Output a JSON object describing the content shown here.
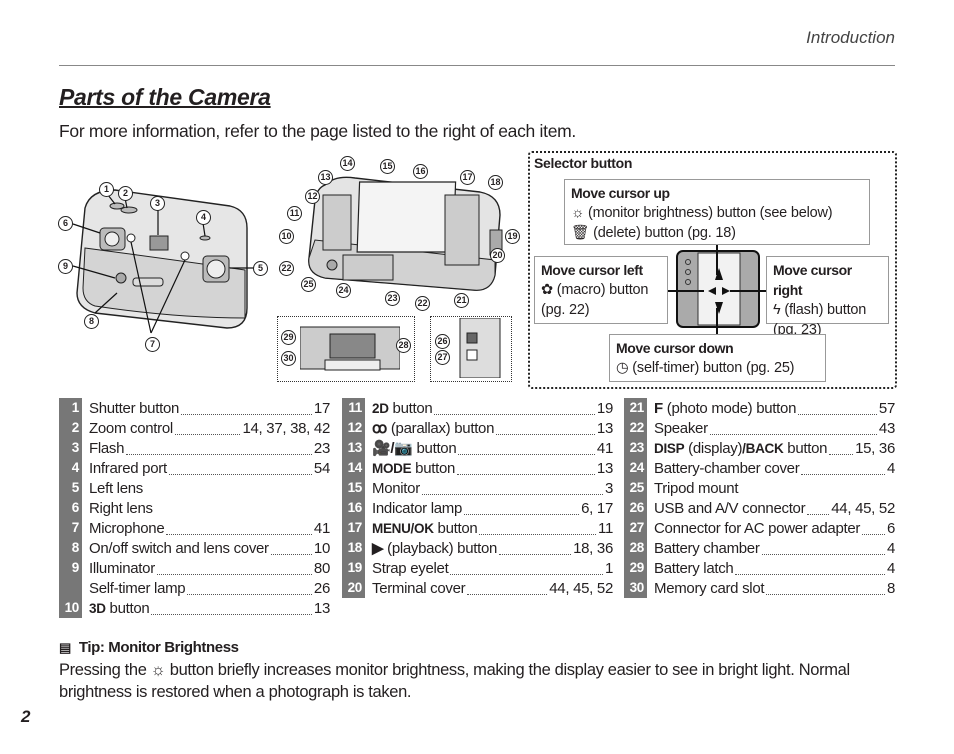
{
  "header": {
    "section": "Introduction"
  },
  "page": {
    "title": "Parts of the Camera",
    "intro": "For more information, refer to the page listed to the right of each item.",
    "number": "2"
  },
  "figures": {
    "front_callouts": [
      "1",
      "2",
      "3",
      "4",
      "5",
      "6",
      "7",
      "8",
      "9"
    ],
    "back_callouts": [
      "10",
      "11",
      "12",
      "13",
      "14",
      "15",
      "16",
      "17",
      "18",
      "19",
      "20",
      "21",
      "22",
      "22",
      "23",
      "24",
      "25"
    ],
    "detail_callouts": [
      "26",
      "27",
      "28",
      "29",
      "30"
    ]
  },
  "selector": {
    "title": "Selector button",
    "up": {
      "heading": "Move cursor up",
      "line1": "(monitor brightness) button (see below)",
      "line2": "(delete) button (pg. 18)"
    },
    "left": {
      "heading": "Move cursor left",
      "line1": "(macro) button",
      "line2": "(pg. 22)"
    },
    "right": {
      "heading": "Move cursor right",
      "line1": "(flash) button",
      "line2": "(pg. 23)"
    },
    "down": {
      "heading": "Move cursor down",
      "line1": "(self-timer) button (pg. 25)"
    }
  },
  "parts": {
    "col1": [
      {
        "n": "1",
        "label": "Shutter button",
        "pages": "17"
      },
      {
        "n": "2",
        "label": "Zoom control",
        "pages": "14, 37, 38, 42"
      },
      {
        "n": "3",
        "label": "Flash",
        "pages": "23"
      },
      {
        "n": "4",
        "label": "Infrared port",
        "pages": "54"
      },
      {
        "n": "5",
        "label": "Left lens",
        "pages": ""
      },
      {
        "n": "6",
        "label": "Right lens",
        "pages": ""
      },
      {
        "n": "7",
        "label": "Microphone",
        "pages": "41"
      },
      {
        "n": "8",
        "label": "On/off switch and lens cover",
        "pages": "10"
      },
      {
        "n": "9",
        "label": "Illuminator",
        "pages": "80"
      },
      {
        "n": "",
        "label": "Self-timer lamp",
        "pages": "26"
      },
      {
        "n": "10",
        "bold": "3D",
        "label": " button",
        "pages": "13"
      }
    ],
    "col2": [
      {
        "n": "11",
        "bold": "2D",
        "label": " button",
        "pages": "19"
      },
      {
        "n": "12",
        "icon": "ꝏ",
        "label": " (parallax) button",
        "pages": "13"
      },
      {
        "n": "13",
        "icon": "🎥/📷",
        "label": " button",
        "pages": "41"
      },
      {
        "n": "14",
        "bold": "MODE",
        "label": " button",
        "pages": "13"
      },
      {
        "n": "15",
        "label": "Monitor",
        "pages": "3"
      },
      {
        "n": "16",
        "label": "Indicator lamp",
        "pages": "6, 17"
      },
      {
        "n": "17",
        "bold": "MENU/OK",
        "label": " button",
        "pages": "11"
      },
      {
        "n": "18",
        "icon": "▶",
        "label": " (playback) button",
        "pages": "18, 36"
      },
      {
        "n": "19",
        "label": "Strap eyelet",
        "pages": "1"
      },
      {
        "n": "20",
        "label": "Terminal cover",
        "pages": "44, 45, 52"
      }
    ],
    "col3": [
      {
        "n": "21",
        "icon": "F",
        "label": " (photo mode) button",
        "pages": "57"
      },
      {
        "n": "22",
        "label": "Speaker",
        "pages": "43"
      },
      {
        "n": "23",
        "bold": "DISP",
        "label": " (display)",
        "bold2": "/BACK",
        "label2": " button",
        "pages": "15, 36"
      },
      {
        "n": "24",
        "label": "Battery-chamber cover",
        "pages": "4"
      },
      {
        "n": "25",
        "label": "Tripod mount",
        "pages": ""
      },
      {
        "n": "26",
        "label": "USB and A/V connector",
        "pages": "44, 45, 52"
      },
      {
        "n": "27",
        "label": "Connector for AC power adapter",
        "pages": "6"
      },
      {
        "n": "28",
        "label": "Battery chamber",
        "pages": "4"
      },
      {
        "n": "29",
        "label": "Battery latch",
        "pages": "4"
      },
      {
        "n": "30",
        "label": "Memory card slot",
        "pages": "8"
      }
    ]
  },
  "tip": {
    "heading": "Tip: Monitor Brightness",
    "body_before": "Pressing the",
    "body_after": "button briefly increases monitor brightness, making the display easier to see in bright light.  Normal brightness is restored when a photograph is taken."
  }
}
